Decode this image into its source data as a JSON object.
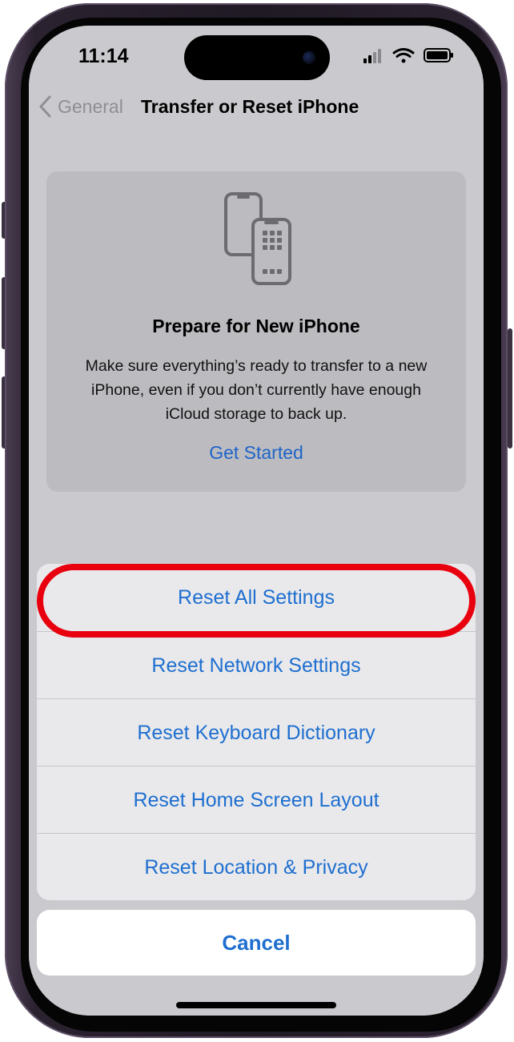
{
  "status_bar": {
    "time": "11:14",
    "icons": [
      "cellular-signal-icon",
      "wifi-icon",
      "battery-icon"
    ]
  },
  "nav": {
    "back_label": "General",
    "title": "Transfer or Reset iPhone"
  },
  "prepare_card": {
    "icon": "transfer-phones-icon",
    "title": "Prepare for New iPhone",
    "description": "Make sure everything’s ready to transfer to a new iPhone, even if you don’t currently have enough iCloud storage to back up.",
    "link": "Get Started"
  },
  "action_sheet": {
    "items": [
      {
        "label": "Reset All Settings",
        "highlighted": true
      },
      {
        "label": "Reset Network Settings"
      },
      {
        "label": "Reset Keyboard Dictionary"
      },
      {
        "label": "Reset Home Screen Layout"
      },
      {
        "label": "Reset Location & Privacy"
      }
    ],
    "cancel": "Cancel"
  },
  "colors": {
    "link_blue": "#1e6fd0",
    "highlight_red": "#e8000e",
    "frame": "#2b2230"
  }
}
